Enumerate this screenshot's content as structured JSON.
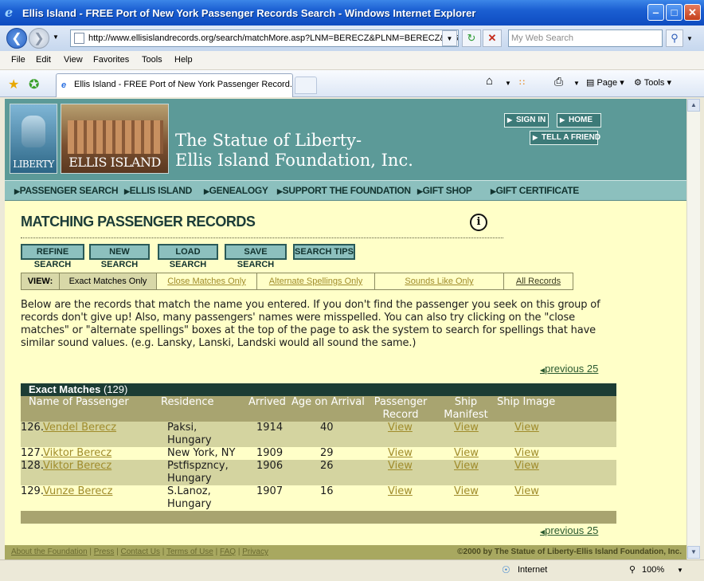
{
  "window": {
    "title": "Ellis Island - FREE Port of New York Passenger Records Search - Windows Internet Explorer",
    "minimize": "‒",
    "maximize": "□",
    "close": "✕"
  },
  "browser": {
    "url": "http://www.ellisislandrecords.org/search/matchMore.asp?LNM=BERECZ&PLNM=BERECZ&CGE",
    "search_placeholder": "My Web Search",
    "menu": [
      "File",
      "Edit",
      "View",
      "Favorites",
      "Tools",
      "Help"
    ],
    "tab_title": "Ellis Island - FREE Port of New York Passenger Record...",
    "toolbar": {
      "page": "Page",
      "tools": "Tools"
    }
  },
  "site": {
    "logo_liberty": "LIBERTY",
    "logo_ellis": "ELLIS ISLAND",
    "org_line1": "The Statue of Liberty-",
    "org_line2": "Ellis Island Foundation, Inc.",
    "header_buttons": {
      "sign_in": "SIGN IN",
      "home": "HOME",
      "tell_friend": "TELL A FRIEND"
    },
    "nav": [
      "PASSENGER SEARCH",
      "ELLIS ISLAND",
      "GENEALOGY",
      "SUPPORT THE FOUNDATION",
      "GIFT SHOP",
      "GIFT CERTIFICATE"
    ]
  },
  "main": {
    "heading": "MATCHING PASSENGER RECORDS",
    "info_icon_label": "i",
    "search_buttons": [
      "REFINE SEARCH",
      "NEW SEARCH",
      "LOAD SEARCH",
      "SAVE SEARCH",
      "SEARCH TIPS"
    ],
    "view": {
      "label": "VIEW:",
      "options": [
        "Exact Matches Only",
        "Close Matches Only",
        "Alternate Spellings Only",
        "Sounds Like Only",
        "All Records"
      ],
      "selected": "Exact Matches Only"
    },
    "description": "Below are the records that match the name you entered. If you don't find the passenger you seek on this group of records don't give up! Also, many passengers' names were misspelled. You can also try clicking on the \"close matches\" or \"alternate spellings\" boxes at the top of the page to ask the system to search for spellings that have similar sound values. (e.g. Lansky, Lanski, Landski would all sound the same.)",
    "previous_label": "previous 25"
  },
  "table": {
    "group_title": "Exact Matches",
    "group_count": "(129)",
    "columns": {
      "name": "Name of Passenger",
      "residence": "Residence",
      "arrived": "Arrived",
      "age": "Age on Arrival",
      "record": "Passenger Record",
      "manifest": "Ship Manifest",
      "image": "Ship Image"
    },
    "rows": [
      {
        "num": "126.",
        "name": "Vendel Berecz",
        "res1": "Paksi,",
        "res2": "Hungary",
        "arrived": "1914",
        "age": "40",
        "record": "View",
        "manifest": "View",
        "image": "View"
      },
      {
        "num": "127.",
        "name": "Viktor Berecz",
        "res1": "New York, NY",
        "res2": "",
        "arrived": "1909",
        "age": "29",
        "record": "View",
        "manifest": "View",
        "image": "View"
      },
      {
        "num": "128.",
        "name": "Viktor Berecz",
        "res1": "Pstfispzncy,",
        "res2": "Hungary",
        "arrived": "1906",
        "age": "26",
        "record": "View",
        "manifest": "View",
        "image": "View"
      },
      {
        "num": "129.",
        "name": "Vunze Berecz",
        "res1": "S.Lanoz,",
        "res2": "Hungary",
        "arrived": "1907",
        "age": "16",
        "record": "View",
        "manifest": "View",
        "image": "View"
      }
    ]
  },
  "footer": {
    "links": [
      "About the Foundation",
      "Press",
      "Contact Us",
      "Terms of Use",
      "FAQ",
      "Privacy"
    ],
    "copyright": "©2000 by The Statue of Liberty-Ellis Island Foundation, Inc."
  },
  "status": {
    "zone": "Internet",
    "zoom": "100%"
  }
}
